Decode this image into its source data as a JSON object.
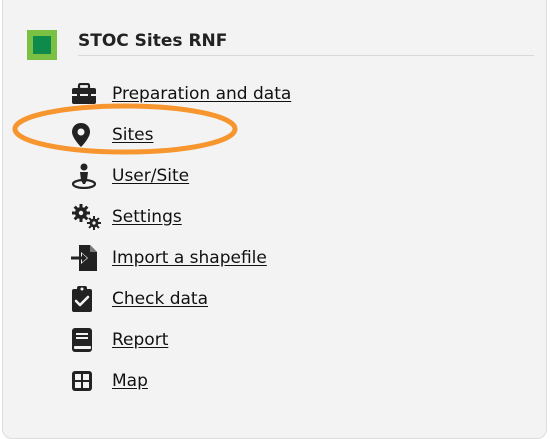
{
  "header": {
    "title": "STOC Sites RNF",
    "logo_outer_color": "#7ac143",
    "logo_inner_color": "#0e8a4a"
  },
  "menu": {
    "items": [
      {
        "label": "Preparation and data",
        "icon": "toolbox-icon"
      },
      {
        "label": "Sites",
        "icon": "map-pin-icon"
      },
      {
        "label": "User/Site",
        "icon": "user-location-icon"
      },
      {
        "label": "Settings",
        "icon": "gears-icon"
      },
      {
        "label": "Import a shapefile",
        "icon": "file-import-icon"
      },
      {
        "label": "Check data",
        "icon": "clipboard-check-icon"
      },
      {
        "label": "Report",
        "icon": "book-icon"
      },
      {
        "label": "Map",
        "icon": "grid-icon"
      }
    ]
  },
  "highlight": {
    "target": "Sites",
    "color": "#f7962e"
  }
}
